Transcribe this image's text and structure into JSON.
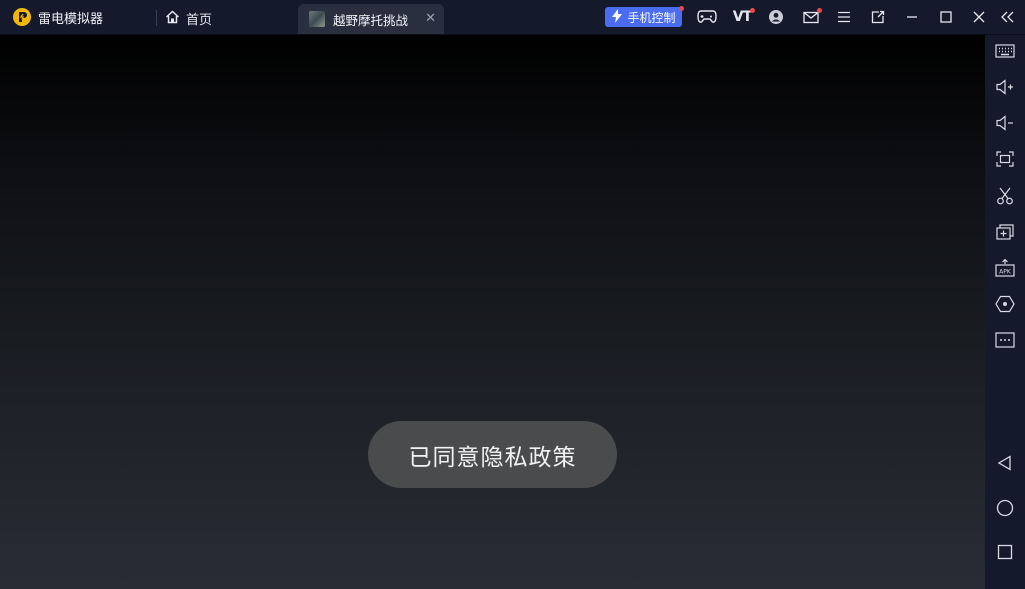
{
  "titlebar": {
    "app_name": "雷电模拟器",
    "home_label": "首页",
    "tab_title": "越野摩托挑战",
    "phone_control_label": "手机控制",
    "vt_label": "VT"
  },
  "icons": {
    "logo": "leidian-logo-icon",
    "home": "home-icon",
    "tab_close": "close-icon",
    "gamepad": "gamepad-icon",
    "avatar": "avatar-icon",
    "mail": "mail-icon",
    "menu": "menu-icon",
    "restore": "restore-icon",
    "minimize": "minimize-icon",
    "maximize": "maximize-icon",
    "close": "close-icon",
    "collapse": "double-chevron-left-icon"
  },
  "sidebar": [
    {
      "name": "keyboard-icon"
    },
    {
      "name": "volume-up-icon"
    },
    {
      "name": "volume-down-icon"
    },
    {
      "name": "fullscreen-icon"
    },
    {
      "name": "scissors-icon"
    },
    {
      "name": "add-window-icon"
    },
    {
      "name": "apk-install-icon"
    },
    {
      "name": "location-icon"
    },
    {
      "name": "more-icon"
    },
    {
      "name": "back-icon"
    },
    {
      "name": "home-circle-icon"
    },
    {
      "name": "recent-apps-icon"
    }
  ],
  "screen": {
    "toast_text": "已同意隐私政策"
  },
  "colors": {
    "titlebar_bg": "#141a2c",
    "accent_blue": "#4a6cf0",
    "notification_red": "#f04848",
    "logo_yellow": "#f5b800"
  }
}
